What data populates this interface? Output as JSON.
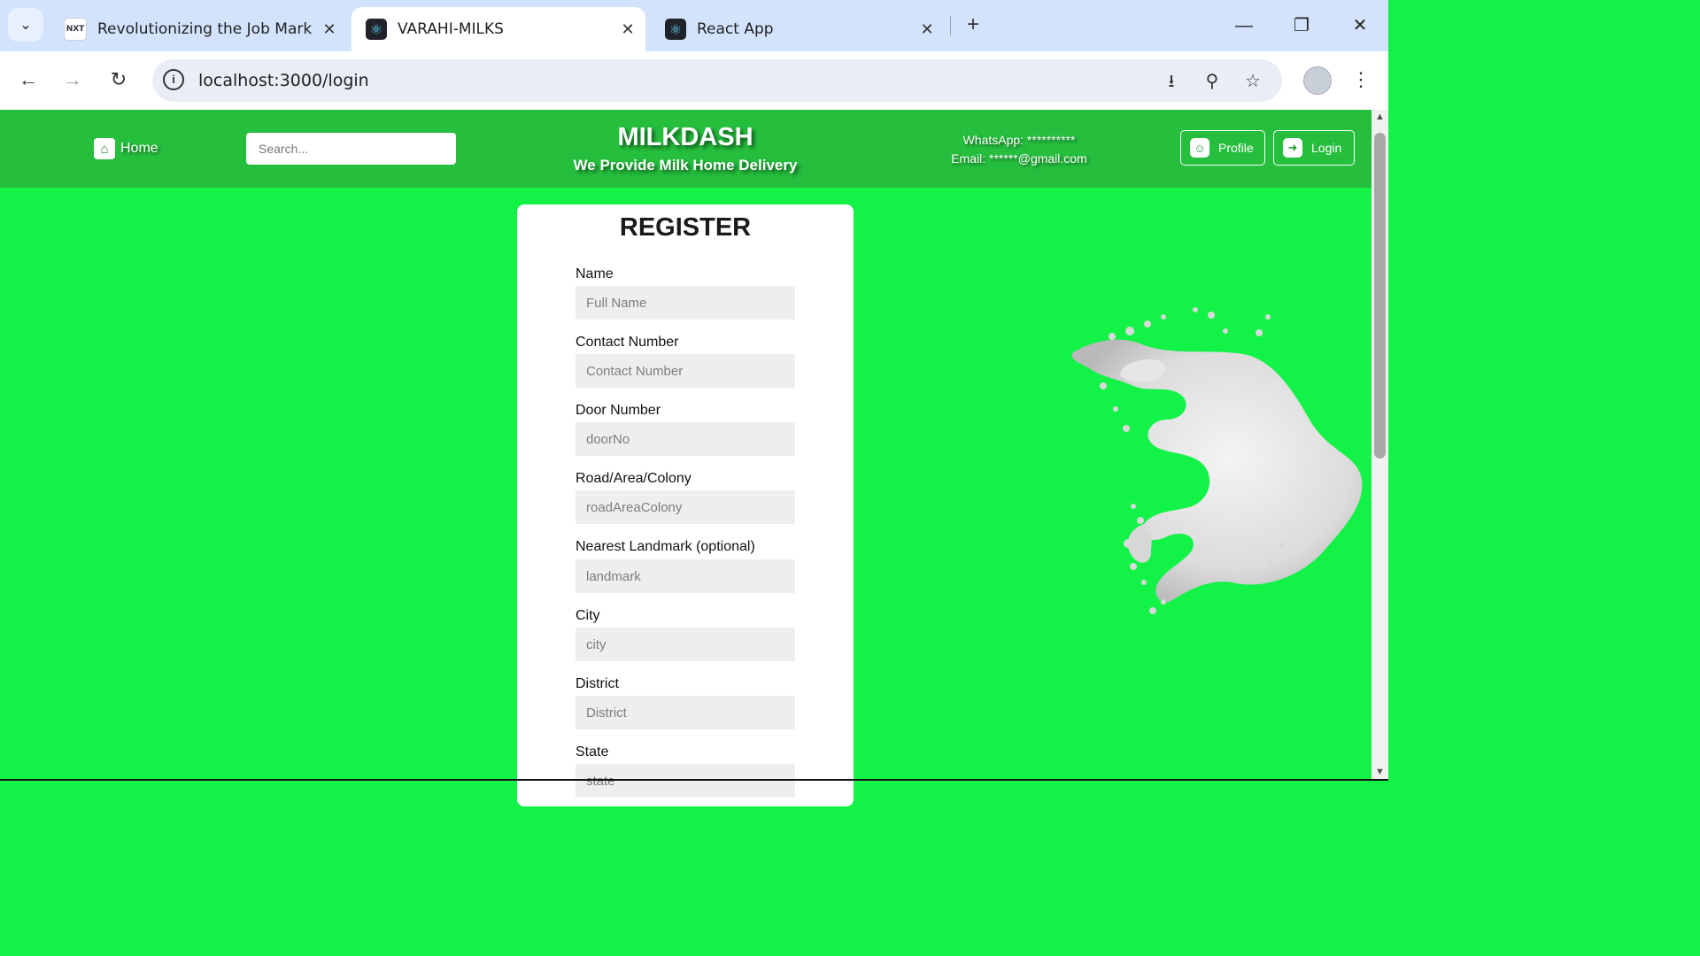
{
  "browser": {
    "tabs": [
      {
        "title": "Revolutionizing the Job Market",
        "icon": "nxtwave-favicon",
        "active": false
      },
      {
        "title": "VARAHI-MILKS",
        "icon": "react-favicon",
        "active": true
      },
      {
        "title": "React App",
        "icon": "react-favicon",
        "active": false
      }
    ],
    "url": "localhost:3000/login"
  },
  "header": {
    "home_label": "Home",
    "search_placeholder": "Search...",
    "brand_title": "MILKDASH",
    "brand_tagline": "We Provide Milk Home Delivery",
    "whatsapp": "WhatsApp: **********",
    "email": "Email: ******@gmail.com",
    "profile_label": "Profile",
    "login_label": "Login"
  },
  "register": {
    "title": "REGISTER",
    "fields": [
      {
        "label": "Name",
        "placeholder": "Full Name"
      },
      {
        "label": "Contact Number",
        "placeholder": "Contact Number"
      },
      {
        "label": "Door Number",
        "placeholder": "doorNo"
      },
      {
        "label": "Road/Area/Colony",
        "placeholder": "roadAreaColony"
      },
      {
        "label": "Nearest Landmark (optional)",
        "placeholder": "landmark"
      },
      {
        "label": "City",
        "placeholder": "city"
      },
      {
        "label": "District",
        "placeholder": "District"
      },
      {
        "label": "State",
        "placeholder": "state"
      }
    ]
  },
  "colors": {
    "page_background": "#12f247",
    "header_background": "#25be3d",
    "card_background": "#ffffff",
    "input_background": "#eeeeee"
  }
}
